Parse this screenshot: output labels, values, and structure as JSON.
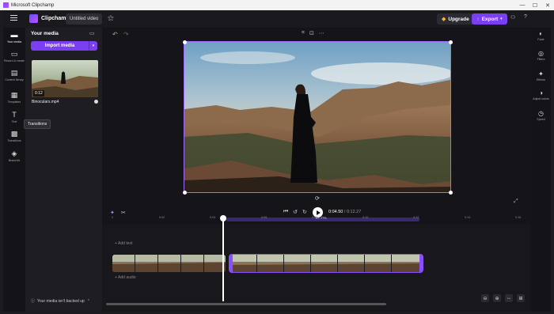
{
  "window": {
    "title": "Microsoft Clipchamp",
    "min": "—",
    "max": "☐",
    "close": "✕"
  },
  "topbar": {
    "brand": "Clipchamp",
    "project_title": "Untitled video",
    "upgrade": "Upgrade",
    "export": "Export"
  },
  "left_rail": [
    {
      "id": "your-media",
      "label": "Your media",
      "icon": "▬"
    },
    {
      "id": "record-create",
      "label": "Record & create",
      "icon": "▭"
    },
    {
      "id": "content-library",
      "label": "Content library",
      "icon": "▤"
    },
    {
      "id": "templates",
      "label": "Templates",
      "icon": "▦"
    },
    {
      "id": "text",
      "label": "Text",
      "icon": "T"
    },
    {
      "id": "transitions",
      "label": "Transitions",
      "icon": "▩"
    },
    {
      "id": "brand-kit",
      "label": "Brand kit",
      "icon": "◈"
    }
  ],
  "tooltip": "Transitions",
  "media_panel": {
    "title": "Your media",
    "import_label": "Import media",
    "file": {
      "name": "Binoculars.mp4",
      "duration": "0:12"
    },
    "backup_text": "Your media isn't backed up"
  },
  "right_rail": [
    {
      "id": "fade",
      "label": "Fade",
      "icon": "◐"
    },
    {
      "id": "filters",
      "label": "Filters",
      "icon": "◎"
    },
    {
      "id": "effects",
      "label": "Effects",
      "icon": "✦"
    },
    {
      "id": "adjust-colors",
      "label": "Adjust colors",
      "icon": "◑"
    },
    {
      "id": "speed",
      "label": "Speed",
      "icon": "◷"
    }
  ],
  "player": {
    "current": "0:04.50",
    "total": "0:12.27",
    "selection": "07.77s"
  },
  "ruler_ticks": [
    "0",
    "0:02",
    "0:04",
    "0:06",
    "0:08",
    "0:10",
    "0:12",
    "0:14",
    "0:16"
  ],
  "timeline": {
    "text_lane": "+ Add text",
    "audio_lane": "+ Add audio"
  },
  "colors": {
    "accent": "#7b3ff2",
    "selection": "#8a4dff"
  }
}
